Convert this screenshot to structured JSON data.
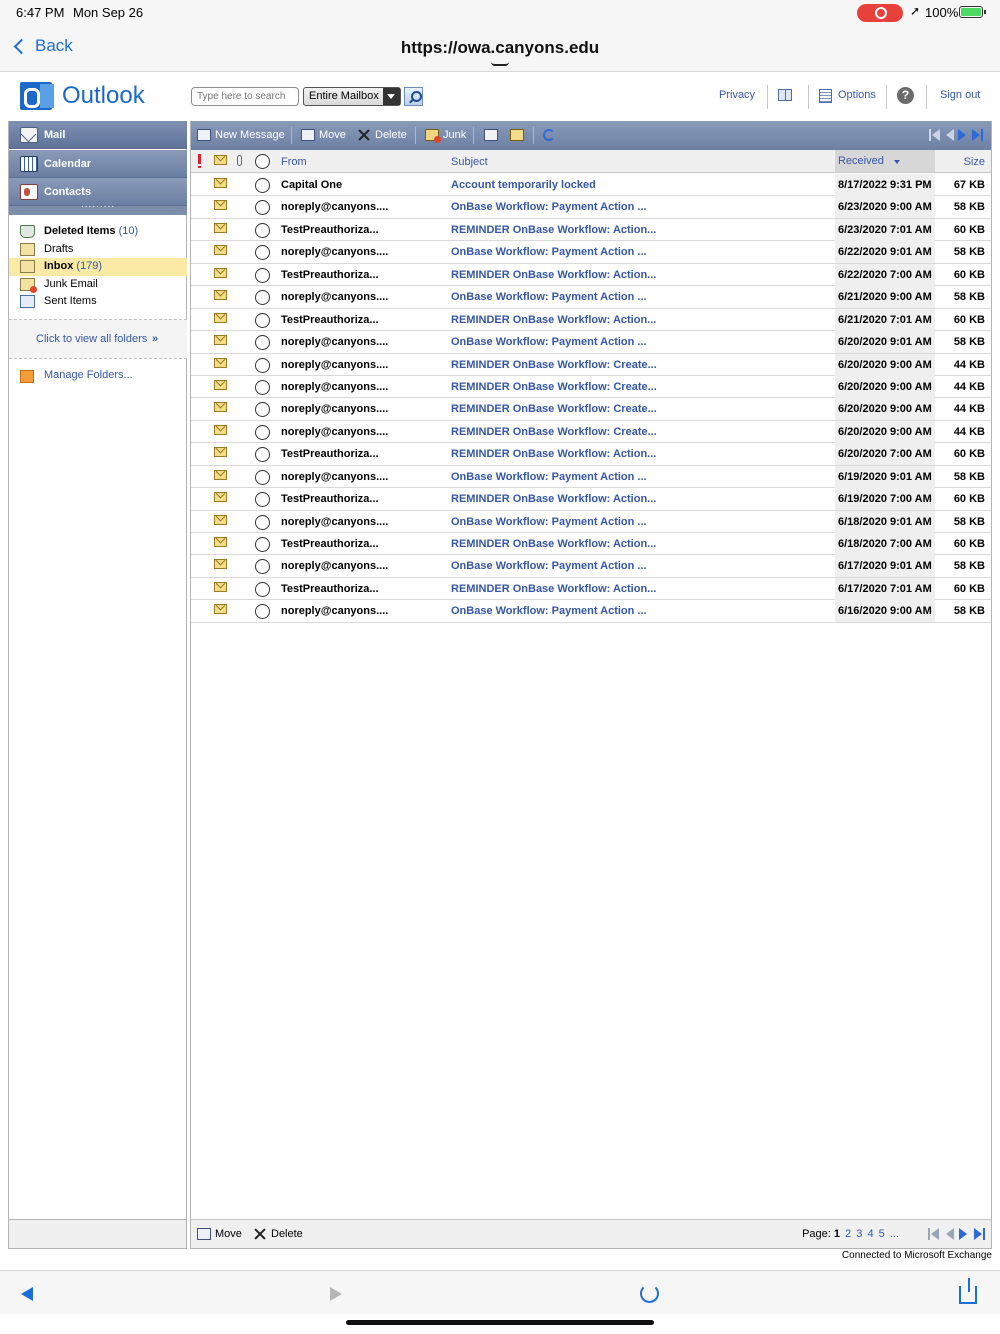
{
  "status_bar": {
    "time": "6:47 PM",
    "date": "Mon Sep 26",
    "battery": "100%"
  },
  "browser": {
    "back_label": "Back",
    "url": "https://owa.canyons.edu"
  },
  "header": {
    "logo_text": "Outlook",
    "search_placeholder": "Type here to search",
    "scope": "Entire Mailbox",
    "privacy": "Privacy",
    "options": "Options",
    "signout": "Sign out"
  },
  "nav": {
    "mail": "Mail",
    "calendar": "Calendar",
    "contacts": "Contacts",
    "folders": [
      {
        "name": "Deleted Items",
        "count": "(10)",
        "bold": true
      },
      {
        "name": "Drafts",
        "count": ""
      },
      {
        "name": "Inbox",
        "count": "(179)",
        "bold": true,
        "selected": true
      },
      {
        "name": "Junk Email",
        "count": ""
      },
      {
        "name": "Sent Items",
        "count": ""
      }
    ],
    "view_all": "Click to view all folders",
    "manage": "Manage Folders..."
  },
  "toolbar": {
    "new_message": "New Message",
    "move": "Move",
    "delete": "Delete",
    "junk": "Junk"
  },
  "columns": {
    "from": "From",
    "subject": "Subject",
    "received": "Received",
    "size": "Size"
  },
  "messages": [
    {
      "from": "Capital One",
      "subject": "Account temporarily locked",
      "received": "8/17/2022 9:31 PM",
      "size": "67 KB"
    },
    {
      "from": "noreply@canyons....",
      "subject": "OnBase Workflow: Payment Action ...",
      "received": "6/23/2020 9:00 AM",
      "size": "58 KB"
    },
    {
      "from": "TestPreauthoriza...",
      "subject": "REMINDER OnBase Workflow: Action...",
      "received": "6/23/2020 7:01 AM",
      "size": "60 KB"
    },
    {
      "from": "noreply@canyons....",
      "subject": "OnBase Workflow: Payment Action ...",
      "received": "6/22/2020 9:01 AM",
      "size": "58 KB"
    },
    {
      "from": "TestPreauthoriza...",
      "subject": "REMINDER OnBase Workflow: Action...",
      "received": "6/22/2020 7:00 AM",
      "size": "60 KB"
    },
    {
      "from": "noreply@canyons....",
      "subject": "OnBase Workflow: Payment Action ...",
      "received": "6/21/2020 9:00 AM",
      "size": "58 KB"
    },
    {
      "from": "TestPreauthoriza...",
      "subject": "REMINDER OnBase Workflow: Action...",
      "received": "6/21/2020 7:01 AM",
      "size": "60 KB"
    },
    {
      "from": "noreply@canyons....",
      "subject": "OnBase Workflow: Payment Action ...",
      "received": "6/20/2020 9:01 AM",
      "size": "58 KB"
    },
    {
      "from": "noreply@canyons....",
      "subject": "REMINDER OnBase Workflow: Create...",
      "received": "6/20/2020 9:00 AM",
      "size": "44 KB"
    },
    {
      "from": "noreply@canyons....",
      "subject": "REMINDER OnBase Workflow: Create...",
      "received": "6/20/2020 9:00 AM",
      "size": "44 KB"
    },
    {
      "from": "noreply@canyons....",
      "subject": "REMINDER OnBase Workflow: Create...",
      "received": "6/20/2020 9:00 AM",
      "size": "44 KB"
    },
    {
      "from": "noreply@canyons....",
      "subject": "REMINDER OnBase Workflow: Create...",
      "received": "6/20/2020 9:00 AM",
      "size": "44 KB"
    },
    {
      "from": "TestPreauthoriza...",
      "subject": "REMINDER OnBase Workflow: Action...",
      "received": "6/20/2020 7:00 AM",
      "size": "60 KB"
    },
    {
      "from": "noreply@canyons....",
      "subject": "OnBase Workflow: Payment Action ...",
      "received": "6/19/2020 9:01 AM",
      "size": "58 KB"
    },
    {
      "from": "TestPreauthoriza...",
      "subject": "REMINDER OnBase Workflow: Action...",
      "received": "6/19/2020 7:00 AM",
      "size": "60 KB"
    },
    {
      "from": "noreply@canyons....",
      "subject": "OnBase Workflow: Payment Action ...",
      "received": "6/18/2020 9:01 AM",
      "size": "58 KB"
    },
    {
      "from": "TestPreauthoriza...",
      "subject": "REMINDER OnBase Workflow: Action...",
      "received": "6/18/2020 7:00 AM",
      "size": "60 KB"
    },
    {
      "from": "noreply@canyons....",
      "subject": "OnBase Workflow: Payment Action ...",
      "received": "6/17/2020 9:01 AM",
      "size": "58 KB"
    },
    {
      "from": "TestPreauthoriza...",
      "subject": "REMINDER OnBase Workflow: Action...",
      "received": "6/17/2020 7:01 AM",
      "size": "60 KB"
    },
    {
      "from": "noreply@canyons....",
      "subject": "OnBase Workflow: Payment Action ...",
      "received": "6/16/2020 9:00 AM",
      "size": "58 KB"
    }
  ],
  "bottom": {
    "move": "Move",
    "delete": "Delete",
    "page_label": "Page:",
    "current_page": "1",
    "pages": [
      "2",
      "3",
      "4",
      "5",
      "..."
    ],
    "connected": "Connected to Microsoft Exchange"
  },
  "colors": {
    "link": "#3557a7",
    "toolbar": "#7e90b2",
    "selected_folder": "#faeaa6",
    "ios_blue": "#1b6ed3"
  }
}
